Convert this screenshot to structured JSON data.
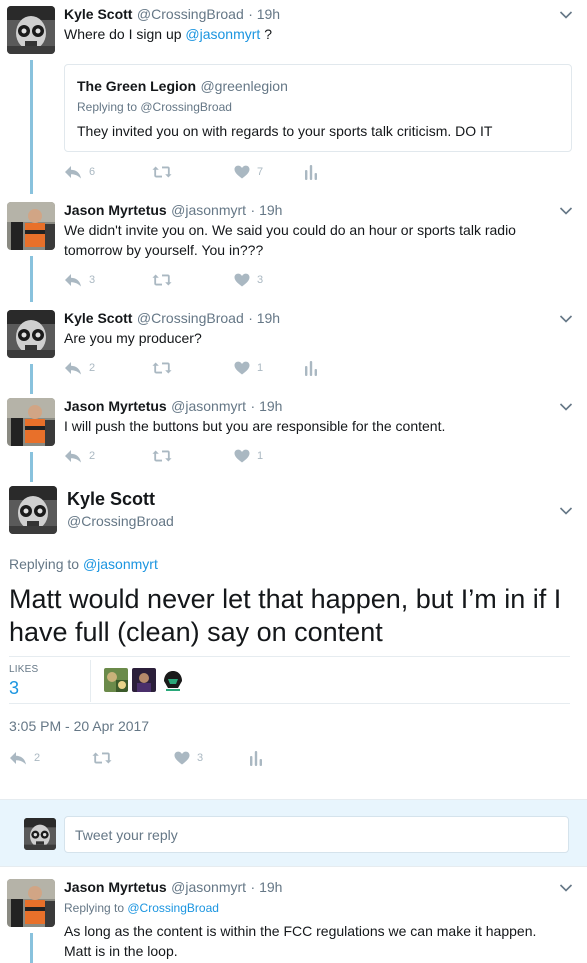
{
  "tweets": [
    {
      "name": "Kyle Scott",
      "handle": "@CrossingBroad",
      "time": "· 19h",
      "text_prefix": "Where do I sign up ",
      "mention": "@jasonmyrt",
      "text_suffix": " ?",
      "quote": {
        "name": "The Green Legion",
        "handle": "@greenlegion",
        "replying": "Replying to @CrossingBroad",
        "text": "They invited you on with regards to your sports talk criticism. DO IT"
      },
      "replies": "6",
      "likes": "7"
    },
    {
      "name": "Jason Myrtetus",
      "handle": "@jasonmyrt",
      "time": "· 19h",
      "text_line1": "We didn't invite you on. We said you could do an hour or sports talk radio",
      "text_line2": "tomorrow by yourself. You in???",
      "replies": "3",
      "likes": "3"
    },
    {
      "name": "Kyle Scott",
      "handle": "@CrossingBroad",
      "time": "· 19h",
      "text": "Are you my producer?",
      "replies": "2",
      "likes": "1"
    },
    {
      "name": "Jason Myrtetus",
      "handle": "@jasonmyrt",
      "time": "· 19h",
      "text": "I will push the buttons but you are responsible for the content.",
      "replies": "2",
      "likes": "1"
    }
  ],
  "main": {
    "name": "Kyle Scott",
    "handle": "@CrossingBroad",
    "replying_prefix": "Replying to ",
    "replying_to": "@jasonmyrt",
    "text_line1": "Matt would never let that happen, but I’m in if I",
    "text_line2": "have full (clean) say on content",
    "likes_label": "LIKES",
    "likes_count": "3",
    "timestamp": "3:05 PM - 20 Apr 2017",
    "replies": "2",
    "likes": "3"
  },
  "reply_box": {
    "placeholder": "Tweet your reply"
  },
  "last_tweet": {
    "name": "Jason Myrtetus",
    "handle": "@jasonmyrt",
    "time": "· 19h",
    "replying_prefix": "Replying to ",
    "replying_to": "@CrossingBroad",
    "text_line1": "As long as the content is within the FCC regulations we can make it happen.",
    "text_line2": "Matt is in the loop."
  },
  "colors": {
    "link": "#1b95e0",
    "thread_line": "#89c2dd",
    "muted": "#657786",
    "action_icon": "#aab8c2",
    "reply_bg": "#e8f5fd"
  }
}
